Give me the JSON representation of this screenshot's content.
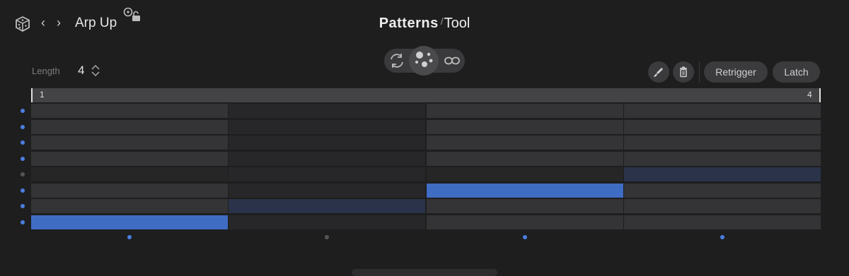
{
  "header": {
    "preset_name": "Arp Up",
    "prev_icon": "‹",
    "next_icon": "›",
    "title_bold": "Patterns",
    "title_sep": "/",
    "title_light": "Tool"
  },
  "length": {
    "label": "Length",
    "value": "4"
  },
  "controls": {
    "retrigger_label": "Retrigger",
    "latch_label": "Latch"
  },
  "timeline": {
    "start_label": "1",
    "end_label": "4"
  },
  "colors": {
    "accent": "#3f6dc4",
    "row_active": "#343436",
    "row_inactive": "#262627",
    "col_dim": "#272729",
    "selected_dim": "#2a3349",
    "dot_active": "#4a7fe0",
    "dot_inactive": "#555555"
  },
  "grid": {
    "columns": 4,
    "rows": 8,
    "row_enabled": [
      true,
      true,
      true,
      true,
      false,
      true,
      true,
      true
    ],
    "column_enabled": [
      true,
      false,
      true,
      true
    ],
    "notes": [
      {
        "row": 7,
        "col": 0,
        "state": "on"
      },
      {
        "row": 6,
        "col": 1,
        "state": "dim"
      },
      {
        "row": 5,
        "col": 2,
        "state": "on"
      },
      {
        "row": 4,
        "col": 3,
        "state": "dim"
      }
    ]
  },
  "icons": {
    "dice": "dice-icon",
    "lock": "lock-icon",
    "cycle": "cycle-icon",
    "random": "random-dots-icon",
    "infinite": "infinity-icon",
    "brush": "brush-icon",
    "trash": "trash-icon",
    "stepper": "stepper-icon"
  }
}
